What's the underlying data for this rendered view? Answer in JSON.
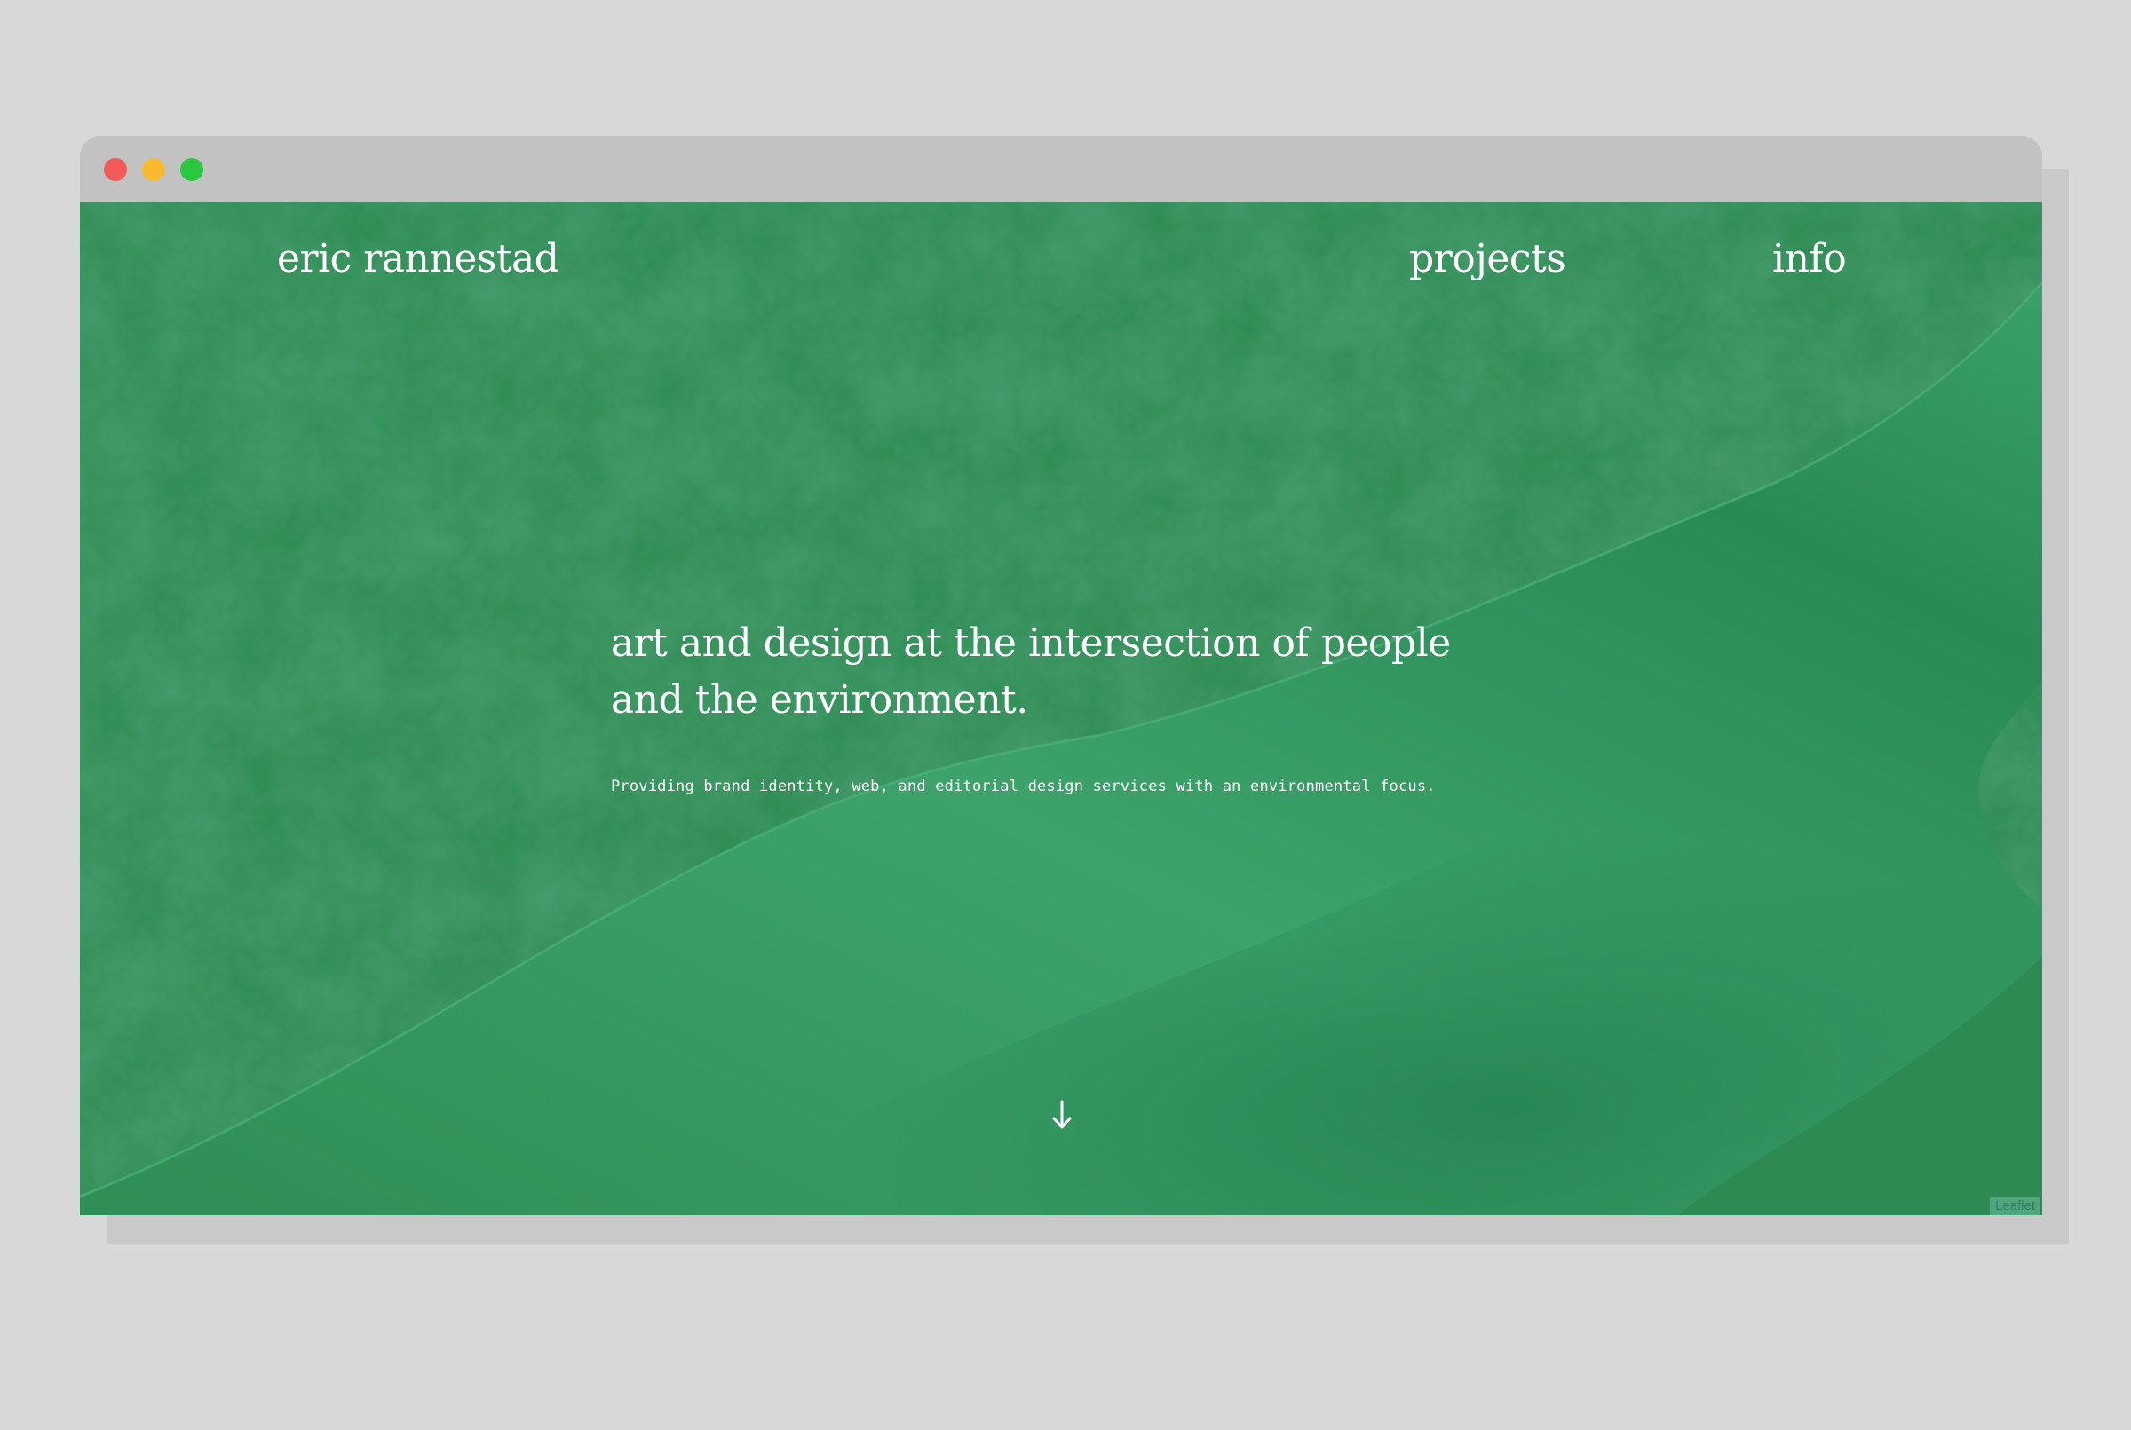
{
  "window": {
    "controls": [
      "close",
      "minimize",
      "maximize"
    ]
  },
  "header": {
    "site_name": "eric rannestad",
    "nav": [
      {
        "label": "projects"
      },
      {
        "label": "info"
      }
    ]
  },
  "hero": {
    "headline": "art and design at the intersection of people and the environment.",
    "subline": "Providing brand identity, web, and editorial design services with an environmental focus.",
    "scroll_icon": "arrow-down-icon"
  },
  "map": {
    "attribution": "Leaflet"
  },
  "colors": {
    "land_green": "#2b8a50",
    "water_green": "#3a9e66",
    "background": "#d8d8d8",
    "titlebar": "#c2c2c2"
  }
}
